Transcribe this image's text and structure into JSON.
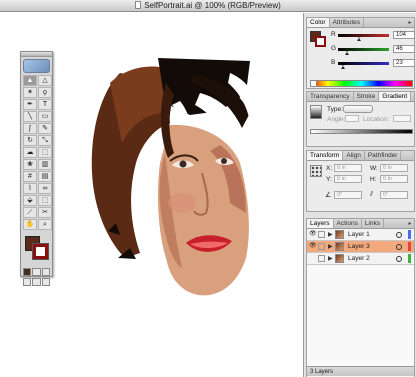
{
  "window": {
    "title": "SelfPortrait.ai @ 100% (RGB/Preview)"
  },
  "tools": {
    "items": [
      {
        "name": "selection-tool",
        "glyph": "▲",
        "active": true
      },
      {
        "name": "direct-selection-tool",
        "glyph": "△"
      },
      {
        "name": "magic-wand-tool",
        "glyph": "✶"
      },
      {
        "name": "lasso-tool",
        "glyph": "ϙ"
      },
      {
        "name": "pen-tool",
        "glyph": "✒"
      },
      {
        "name": "type-tool",
        "glyph": "T"
      },
      {
        "name": "line-tool",
        "glyph": "╲"
      },
      {
        "name": "rectangle-tool",
        "glyph": "▭"
      },
      {
        "name": "paintbrush-tool",
        "glyph": "∫"
      },
      {
        "name": "pencil-tool",
        "glyph": "✎"
      },
      {
        "name": "rotate-tool",
        "glyph": "↻"
      },
      {
        "name": "scale-tool",
        "glyph": "⤡"
      },
      {
        "name": "warp-tool",
        "glyph": "☁"
      },
      {
        "name": "free-transform-tool",
        "glyph": "⬚"
      },
      {
        "name": "symbol-sprayer-tool",
        "glyph": "❀"
      },
      {
        "name": "graph-tool",
        "glyph": "▥"
      },
      {
        "name": "mesh-tool",
        "glyph": "#"
      },
      {
        "name": "gradient-tool",
        "glyph": "▤"
      },
      {
        "name": "eyedropper-tool",
        "glyph": "⌇"
      },
      {
        "name": "blend-tool",
        "glyph": "∞"
      },
      {
        "name": "live-paint-bucket-tool",
        "glyph": "⬙"
      },
      {
        "name": "live-paint-selection-tool",
        "glyph": "⬚"
      },
      {
        "name": "slice-tool",
        "glyph": "⟋"
      },
      {
        "name": "scissors-tool",
        "glyph": "✂"
      },
      {
        "name": "hand-tool",
        "glyph": "✋"
      },
      {
        "name": "zoom-tool",
        "glyph": "⌕"
      }
    ],
    "fill_color": "#5c2a1a",
    "stroke_color": "#8a1010"
  },
  "color_panel": {
    "tabs": [
      "Color",
      "Attributes"
    ],
    "sliders": [
      {
        "label": "R",
        "value": "104",
        "color": "#c03030",
        "level": 0.41
      },
      {
        "label": "G",
        "value": "46",
        "color": "#30a030",
        "level": 0.18
      },
      {
        "label": "B",
        "value": "23",
        "color": "#3030c0",
        "level": 0.09
      }
    ]
  },
  "transparency_panel": {
    "tabs": [
      "Transparency",
      "Stroke",
      "Gradient"
    ],
    "type_label": "Type:",
    "angle_label": "Angle:",
    "location_label": "Location:"
  },
  "transform_panel": {
    "tabs": [
      "Transform",
      "Align",
      "Pathfinder"
    ],
    "x_label": "X:",
    "x_value": "0 in",
    "y_label": "Y:",
    "y_value": "0 in",
    "w_label": "W:",
    "w_value": "0 in",
    "h_label": "H:",
    "h_value": "0 in",
    "rotate_value": "0°",
    "shear_value": "0°"
  },
  "layers_panel": {
    "tabs": [
      "Layers",
      "Actions",
      "Links"
    ],
    "layers": [
      {
        "name": "Layer 1",
        "color": "#4a6cf0",
        "visible": true,
        "selected": false
      },
      {
        "name": "Layer 3",
        "color": "#e04040",
        "visible": true,
        "selected": true
      },
      {
        "name": "Layer 2",
        "color": "#40b040",
        "visible": false,
        "selected": false
      }
    ],
    "footer": "3 Layers"
  }
}
